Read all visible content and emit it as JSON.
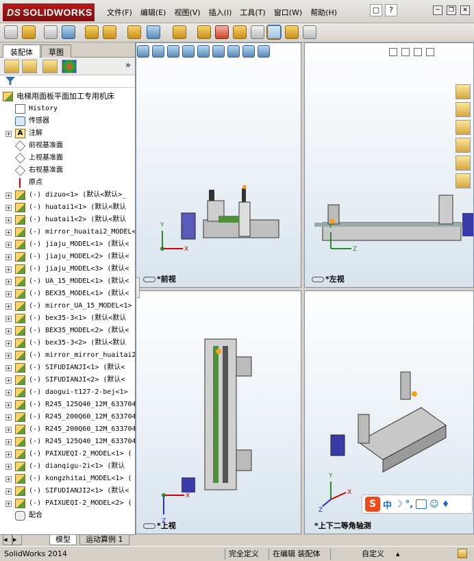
{
  "app": {
    "brand_ds": "DS",
    "brand": "SOLIDWORKS"
  },
  "menu": {
    "items": [
      "文件(F)",
      "编辑(E)",
      "视图(V)",
      "插入(I)",
      "工具(T)",
      "窗口(W)",
      "帮助(H)"
    ]
  },
  "feature_tree": {
    "tabs": [
      "装配体",
      "草图"
    ],
    "root": "电梯用面板平面加工专用机床",
    "items": [
      {
        "label": "History",
        "icon": "history-icon",
        "expand": ""
      },
      {
        "label": "传感器",
        "icon": "sensor-icon",
        "expand": ""
      },
      {
        "label": "注解",
        "icon": "annotation-icon",
        "expand": "+"
      },
      {
        "label": "前视基准面",
        "icon": "plane-icon",
        "expand": ""
      },
      {
        "label": "上视基准面",
        "icon": "plane-icon",
        "expand": ""
      },
      {
        "label": "右视基准面",
        "icon": "plane-icon",
        "expand": ""
      },
      {
        "label": "原点",
        "icon": "origin-icon",
        "expand": ""
      },
      {
        "label": "(-) dizuo<1> (默认<默认>_",
        "icon": "part-icon",
        "expand": "+"
      },
      {
        "label": "(-) huatai1<1> (默认<默认",
        "icon": "part-icon",
        "expand": "+"
      },
      {
        "label": "(-) huatai1<2> (默认<默认",
        "icon": "part-icon",
        "expand": "+"
      },
      {
        "label": "(-) mirror_huaitai2_MODEL<",
        "icon": "part-icon",
        "expand": "+"
      },
      {
        "label": "(-) jiaju_MODEL<1> (默认<",
        "icon": "part-icon",
        "expand": "+"
      },
      {
        "label": "(-) jiaju_MODEL<2> (默认<",
        "icon": "part-icon",
        "expand": "+"
      },
      {
        "label": "(-) jiaju_MODEL<3> (默认<",
        "icon": "part-icon",
        "expand": "+"
      },
      {
        "label": "(-) UA_15_MODEL<1> (默认<",
        "icon": "part-icon",
        "expand": "+"
      },
      {
        "label": "(-) BEX35_MODEL<1> (默认<",
        "icon": "part-icon",
        "expand": "+"
      },
      {
        "label": "(-) mirror_UA_15_MODEL<1>",
        "icon": "part-icon",
        "expand": "+"
      },
      {
        "label": "(-) bex35-3<1> (默认<默认",
        "icon": "part-icon",
        "expand": "+"
      },
      {
        "label": "(-) BEX35_MODEL<2> (默认<",
        "icon": "part-icon",
        "expand": "+"
      },
      {
        "label": "(-) bex35-3<2> (默认<默认",
        "icon": "part-icon",
        "expand": "+"
      },
      {
        "label": "(-) mirror_mirror_huaitai2",
        "icon": "part-icon",
        "expand": "+"
      },
      {
        "label": "(-) SIFUDIANJI<1> (默认<",
        "icon": "part-icon",
        "expand": "+"
      },
      {
        "label": "(-) SIFUDIANJI<2> (默认<",
        "icon": "part-icon",
        "expand": "+"
      },
      {
        "label": "(-) daogui-t127-2-bej<1>",
        "icon": "part-icon",
        "expand": "+"
      },
      {
        "label": "(-) R245_125Q40_12M_633704",
        "icon": "part-icon",
        "expand": "+"
      },
      {
        "label": "(-) R245_200Q60_12M_633704",
        "icon": "part-icon",
        "expand": "+"
      },
      {
        "label": "(-) R245_200Q60_12M_633704",
        "icon": "part-icon",
        "expand": "+"
      },
      {
        "label": "(-) R245_125Q40_12M_633704",
        "icon": "part-icon",
        "expand": "+"
      },
      {
        "label": "(-) PAIXUEQI-2_MODEL<1> (",
        "icon": "part-icon",
        "expand": "+"
      },
      {
        "label": "(-) dianqigu-2i<1> (默认",
        "icon": "part-icon",
        "expand": "+"
      },
      {
        "label": "(-) kongzhitai_MODEL<1> (",
        "icon": "part-icon",
        "expand": "+"
      },
      {
        "label": "(-) SIFUDIANJI2<1> (默认<",
        "icon": "part-icon",
        "expand": "+"
      },
      {
        "label": "(-) PAIXUEQI-2_MODEL<2> (",
        "icon": "part-icon",
        "expand": "+"
      },
      {
        "label": "配合",
        "icon": "mate-icon",
        "expand": ""
      }
    ],
    "bottom_tabs": [
      "模型",
      "运动算例 1"
    ]
  },
  "viewports": {
    "front": {
      "title": "*前视"
    },
    "left": {
      "title": "*左视"
    },
    "top": {
      "title": "*上视"
    },
    "iso": {
      "title": "*上下二等角轴测"
    }
  },
  "triad": {
    "x": "X",
    "y": "Y",
    "z": "Z"
  },
  "ime": {
    "logo": "S",
    "mode": "中"
  },
  "status": {
    "app_version": "SolidWorks 2014",
    "definition": "完全定义",
    "editing": "在编辑 装配体",
    "units": "自定义"
  }
}
